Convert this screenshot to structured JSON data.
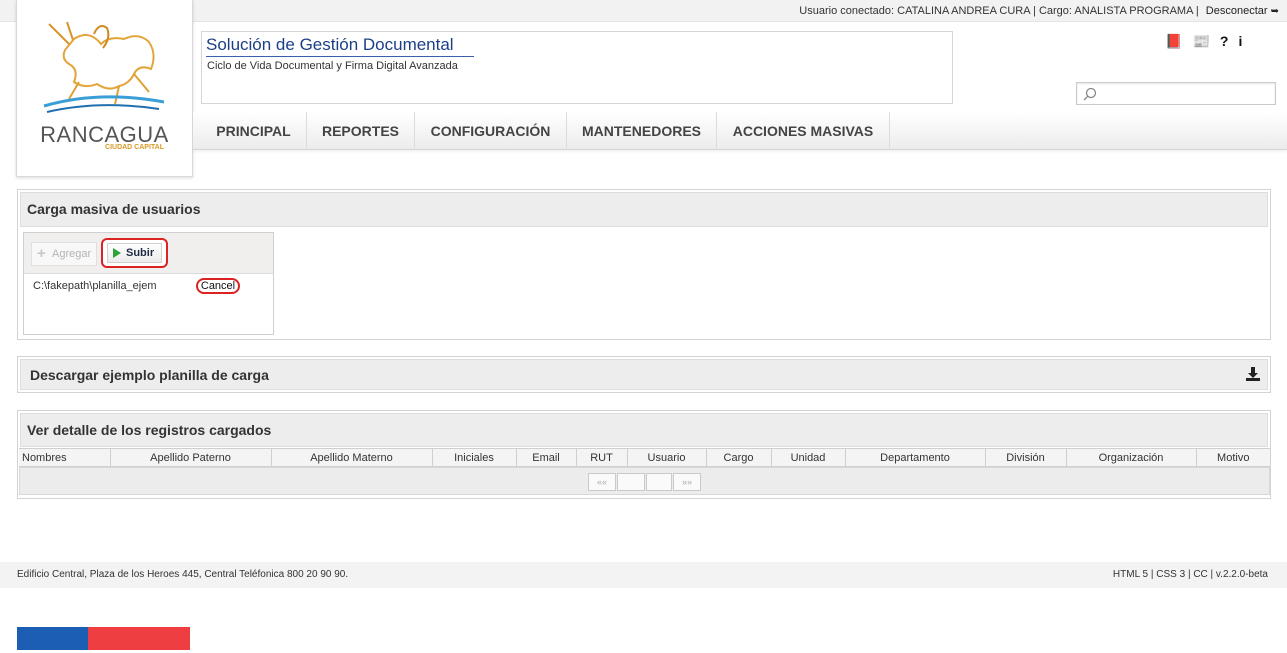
{
  "topbar": {
    "user_info": "Usuario conectado: CATALINA ANDREA CURA | Cargo: ANALISTA PROGRAMA |",
    "logout": "Desconectar"
  },
  "logo": {
    "name": "RANCAGUA",
    "subtitle": "CIUDAD CAPITAL"
  },
  "header": {
    "title": "Solución de Gestión Documental",
    "subtitle": "Ciclo de Vida Documental y Firma Digital Avanzada",
    "icons": [
      "manual-icon",
      "news-icon",
      "help-icon",
      "info-icon"
    ],
    "search": {
      "value": "",
      "placeholder": ""
    }
  },
  "nav": {
    "items": [
      "PRINCIPAL",
      "REPORTES",
      "CONFIGURACIÓN",
      "MANTENEDORES",
      "ACCIONES MASIVAS"
    ]
  },
  "upload_panel": {
    "title": "Carga masiva de usuarios",
    "add_label": "Agregar",
    "upload_label": "Subir",
    "file_name": "C:\\fakepath\\planilla_ejem",
    "cancel_label": "Cancel"
  },
  "download_panel": {
    "title": "Descargar ejemplo planilla de carga"
  },
  "detail_panel": {
    "title": "Ver detalle de los registros cargados",
    "columns": [
      "Nombres",
      "Apellido Paterno",
      "Apellido Materno",
      "Iniciales",
      "Email",
      "RUT",
      "Usuario",
      "Cargo",
      "Unidad",
      "Departamento",
      "División",
      "Organización",
      "Motivo"
    ],
    "pager": {
      "prev": "««",
      "next": "»»"
    }
  },
  "footer": {
    "address": "Edificio Central, Plaza de los Heroes 445, Central Teléfonica 800 20 90 90.",
    "version": "HTML 5 | CSS 3 | CC | v.2.2.0-beta"
  },
  "colors": {
    "flag_blue": "#1b5eb3",
    "flag_red": "#ef3e42",
    "accent": "#1b3f86",
    "highlight": "#dd2222"
  }
}
